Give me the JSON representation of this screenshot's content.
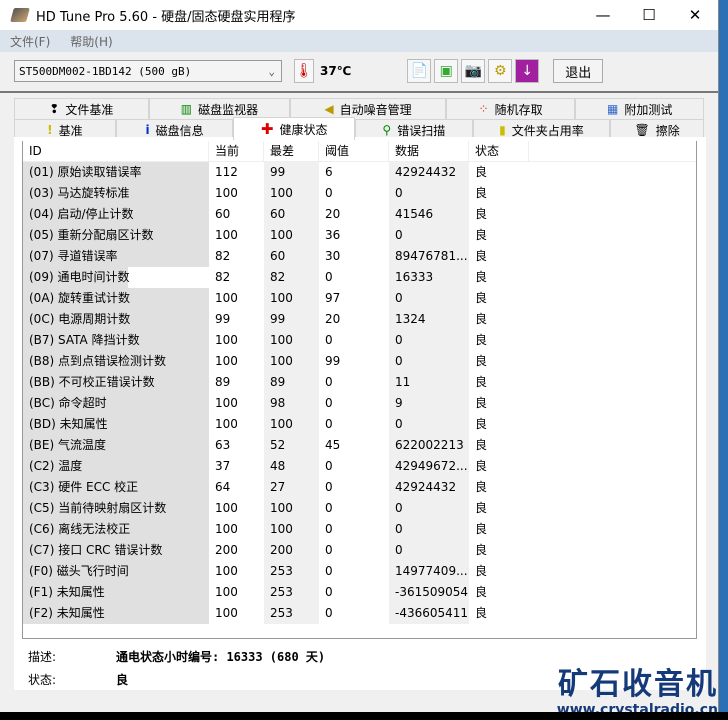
{
  "window": {
    "title": "HD Tune Pro 5.60 - 硬盘/固态硬盘实用程序",
    "minimize": "—",
    "maximize": "☐",
    "close": "✕"
  },
  "menu": [
    "文件(F)",
    "帮助(H)"
  ],
  "toolbar": {
    "drive": "ST500DM002-1BD142 (500 gB)",
    "temperature": "37℃",
    "exit": "退出"
  },
  "tabs_top": [
    {
      "icon": "❢",
      "label": "文件基准"
    },
    {
      "icon": "▥",
      "label": "磁盘监视器"
    },
    {
      "icon": "◀",
      "label": "自动噪音管理"
    },
    {
      "icon": "⁘",
      "label": "随机存取"
    },
    {
      "icon": "▦",
      "label": "附加测试"
    }
  ],
  "tabs_bottom": [
    {
      "icon": "!",
      "label": "基准"
    },
    {
      "icon": "i",
      "label": "磁盘信息"
    },
    {
      "icon": "✚",
      "label": "健康状态"
    },
    {
      "icon": "⚲",
      "label": "错误扫描"
    },
    {
      "icon": "▮",
      "label": "文件夹占用率"
    },
    {
      "icon": "🗑",
      "label": "擦除"
    }
  ],
  "table": {
    "headers": [
      "ID",
      "当前",
      "最差",
      "阈值",
      "数据",
      "状态"
    ],
    "rows": [
      [
        "(01) 原始读取错误率",
        "112",
        "99",
        "6",
        "42924432",
        "良"
      ],
      [
        "(03) 马达旋转标准",
        "100",
        "100",
        "0",
        "0",
        "良"
      ],
      [
        "(04) 启动/停止计数",
        "60",
        "60",
        "20",
        "41546",
        "良"
      ],
      [
        "(05) 重新分配扇区计数",
        "100",
        "100",
        "36",
        "0",
        "良"
      ],
      [
        "(07) 寻道错误率",
        "82",
        "60",
        "30",
        "89476781...",
        "良"
      ],
      [
        "(09) 通电时间计数",
        "82",
        "82",
        "0",
        "16333",
        "良"
      ],
      [
        "(0A) 旋转重试计数",
        "100",
        "100",
        "97",
        "0",
        "良"
      ],
      [
        "(0C) 电源周期计数",
        "99",
        "99",
        "20",
        "1324",
        "良"
      ],
      [
        "(B7) SATA 降挡计数",
        "100",
        "100",
        "0",
        "0",
        "良"
      ],
      [
        "(B8) 点到点错误检测计数",
        "100",
        "100",
        "99",
        "0",
        "良"
      ],
      [
        "(BB) 不可校正错误计数",
        "89",
        "89",
        "0",
        "11",
        "良"
      ],
      [
        "(BC) 命令超时",
        "100",
        "98",
        "0",
        "9",
        "良"
      ],
      [
        "(BD) 未知属性",
        "100",
        "100",
        "0",
        "0",
        "良"
      ],
      [
        "(BE) 气流温度",
        "63",
        "52",
        "45",
        "622002213",
        "良"
      ],
      [
        "(C2) 温度",
        "37",
        "48",
        "0",
        "42949672...",
        "良"
      ],
      [
        "(C3) 硬件 ECC 校正",
        "64",
        "27",
        "0",
        "42924432",
        "良"
      ],
      [
        "(C5) 当前待映射扇区计数",
        "100",
        "100",
        "0",
        "0",
        "良"
      ],
      [
        "(C6) 离线无法校正",
        "100",
        "100",
        "0",
        "0",
        "良"
      ],
      [
        "(C7) 接口 CRC 错误计数",
        "200",
        "200",
        "0",
        "0",
        "良"
      ],
      [
        "(F0) 磁头飞行时间",
        "100",
        "253",
        "0",
        "14977409...",
        "良"
      ],
      [
        "(F1) 未知属性",
        "100",
        "253",
        "0",
        "-361509054",
        "良"
      ],
      [
        "(F2) 未知属性",
        "100",
        "253",
        "0",
        "-436605411",
        "良"
      ]
    ]
  },
  "details": {
    "desc_label": "描述:",
    "desc_value": "通电状态小时编号: 16333 (680 天)",
    "status_label": "状态:",
    "status_value": "良"
  },
  "watermark": {
    "name": "矿石收音机",
    "url": "www.crystalradio.cn"
  }
}
